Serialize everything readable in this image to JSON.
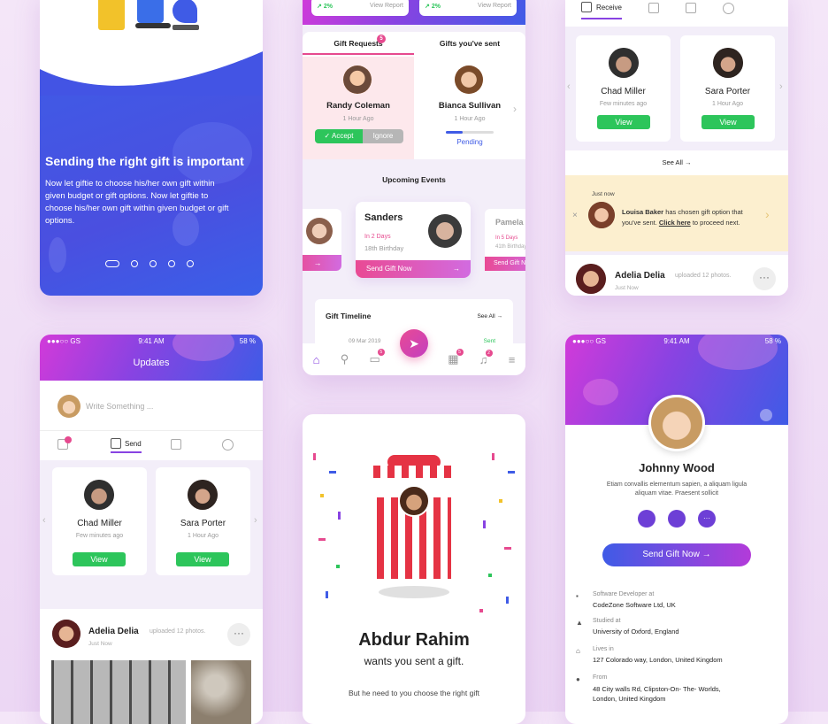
{
  "onboard": {
    "title": "Sending the right gift is important",
    "body": "Now let giftie to choose his/her own gift within given budget or gift options. Now let giftie to choose his/her own gift within given budget or gift options."
  },
  "gifts": {
    "stat1": "2%",
    "stat2": "2%",
    "view_report": "View Report",
    "tab_requests": "Gift Requests",
    "tab_requests_badge": "5",
    "tab_sent": "Gifts you've sent",
    "req": {
      "name": "Randy Coleman",
      "time": "1 Hour Ago",
      "accept": "Accept",
      "ignore": "Ignore"
    },
    "sent": {
      "name": "Bianca Sullivan",
      "time": "1 Hour Ago",
      "status": "Pending",
      "progress": 0.35
    },
    "upcoming_title": "Upcoming Events",
    "event": {
      "name": "Sanders",
      "days": "In 2 Days",
      "type": "18th Birthday",
      "button": "Send Gift Now"
    },
    "event2": {
      "name": "Pamela",
      "days": "In 5 Days",
      "type": "41th Birthday",
      "button": "Send Gift N"
    },
    "timeline_title": "Gift Timeline",
    "timeline_see_all": "See All",
    "timeline_date": "09 Mar 2019",
    "timeline_status": "Sent",
    "nav_badge1": "5",
    "nav_badge2": "5",
    "nav_badge3": "2"
  },
  "receive": {
    "tab_label": "Receive",
    "people": [
      {
        "name": "Chad Miller",
        "time": "Few minutes ago",
        "button": "View"
      },
      {
        "name": "Sara Porter",
        "time": "1 Hour Ago",
        "button": "View"
      }
    ],
    "see_all": "See All",
    "notif": {
      "time": "Just now",
      "name": "Louisa Baker",
      "text1": " has chosen gift option that you've sent. ",
      "link": "Click here",
      "text2": " to proceed next."
    },
    "post": {
      "name": "Adelia Delia",
      "action": "uploaded 12 photos.",
      "time": "Just Now"
    }
  },
  "updates": {
    "status_left": "●●●○○ GS",
    "time": "9:41 AM",
    "battery": "58 %",
    "title": "Updates",
    "write_placeholder": "Write Something ...",
    "tab_send": "Send",
    "people": [
      {
        "name": "Chad Miller",
        "time": "Few minutes ago",
        "button": "View"
      },
      {
        "name": "Sara Porter",
        "time": "1 Hour Ago",
        "button": "View"
      }
    ],
    "post": {
      "name": "Adelia Delia",
      "action": "uploaded 12 photos.",
      "time": "Just Now"
    }
  },
  "giftbox": {
    "name": "Abdur Rahim",
    "line": "wants you sent a gift.",
    "sub": "But he need to you choose the right gift"
  },
  "profile": {
    "status_left": "●●●○○ GS",
    "time": "9:41 AM",
    "battery": "58 %",
    "name": "Johnny Wood",
    "bio": "Etiam convallis elementum sapien, a aliquam ligula aliquam vitae. Praesent sollicit",
    "button": "Send Gift Now",
    "rows": [
      {
        "label": "Software Developer at",
        "value": "CodeZone Software Ltd, UK"
      },
      {
        "label": "Studied at",
        "value": "University of Oxford, England"
      },
      {
        "label": "Lives in",
        "value": "127 Colorado way, London, United Kingdom"
      },
      {
        "label": "From",
        "value": "48 City walls Rd, Clipston-On- The- Worlds, London, United Kingdom"
      }
    ]
  },
  "colors": {
    "accent": "#e64a8f",
    "green": "#2dc55b",
    "purple": "#8843e2",
    "blue": "#3f5be6"
  }
}
